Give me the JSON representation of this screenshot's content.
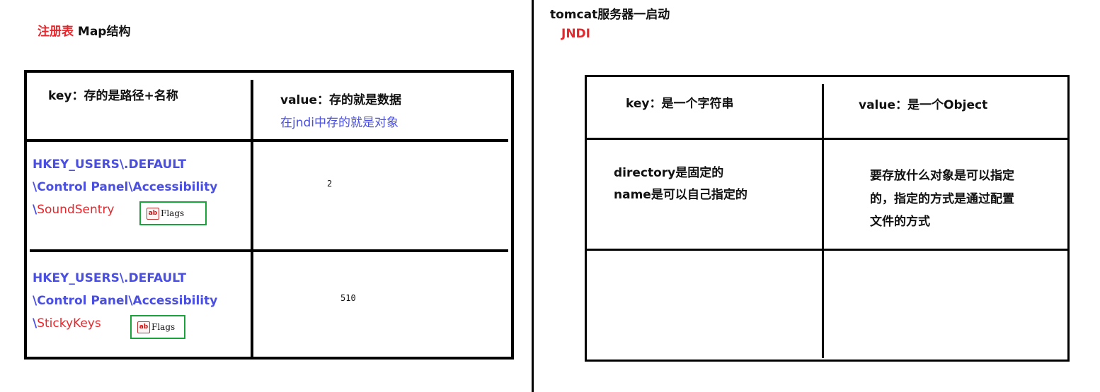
{
  "left": {
    "title_part1": "注册表",
    "title_part2": " Map结构",
    "table": {
      "header_key": "key：存的是路径+名称",
      "header_value_line1": "value：存的就是数据",
      "header_value_line2": "在jndi中存的就是对象",
      "rows": [
        {
          "path_line1": "HKEY_USERS\\.DEFAULT",
          "path_line2": "\\Control Panel\\Accessibility",
          "path_slash": "\\",
          "path_name": "SoundSentry",
          "flag_icon": "ab",
          "flag_label": "Flags",
          "value": "2"
        },
        {
          "path_line1": "HKEY_USERS\\.DEFAULT",
          "path_line2": "\\Control Panel\\Accessibility",
          "path_slash": "\\",
          "path_name": "StickyKeys",
          "flag_icon": "ab",
          "flag_label": "Flags",
          "value": "510"
        }
      ]
    }
  },
  "right": {
    "title": "tomcat服务器一启动",
    "subtitle": "JNDI",
    "table": {
      "header_key": "key：是一个字符串",
      "header_value": "value：是一个Object",
      "row1_key_line1": "directory是固定的",
      "row1_key_line2": "name是可以自己指定的",
      "row1_value_line1": "要存放什么对象是可以指定",
      "row1_value_line2": "的，指定的方式是通过配置",
      "row1_value_line3": "文件的方式"
    }
  },
  "colors": {
    "red": "#e8262b",
    "blue": "#4a4fe0",
    "green_box": "#1aa33a"
  },
  "icons": {
    "flag_icon": "registry-string-value-icon"
  }
}
